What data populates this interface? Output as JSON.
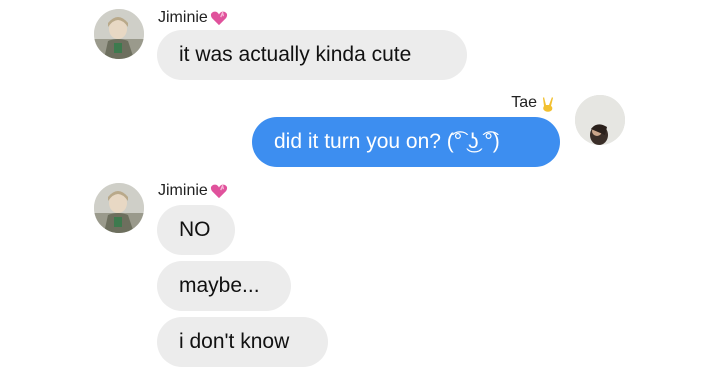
{
  "conversation": {
    "messages": [
      {
        "sender": "Jiminie",
        "text": "it was actually kinda cute"
      },
      {
        "sender": "Tae",
        "text": "did it turn you on? (͡° ͜ʖ ͡°)"
      },
      {
        "sender": "Jiminie",
        "text": "NO"
      },
      {
        "text": "maybe..."
      },
      {
        "text": "i don't know"
      }
    ]
  },
  "colors": {
    "outgoing_bubble": "#3d8ef0",
    "incoming_bubble": "#ececec"
  },
  "icons": {
    "jiminie_badge": "pink-heart-icon",
    "tae_badge": "victory-hand-icon"
  }
}
